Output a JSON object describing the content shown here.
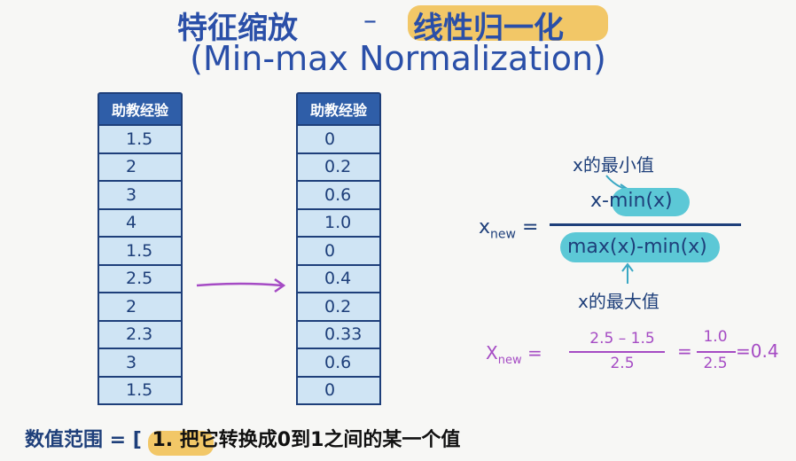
{
  "title": {
    "part1": "特征缩放",
    "separator": "–",
    "part2": "线性归一化",
    "subtitle": "(Min-max Normalization)"
  },
  "table_left": {
    "header": "助教经验",
    "values": [
      "1.5",
      "2",
      "3",
      "4",
      "1.5",
      "2.5",
      "2",
      "2.3",
      "3",
      "1.5"
    ]
  },
  "table_right": {
    "header": "助教经验",
    "values": [
      "0",
      "0.2",
      "0.6",
      "1.0",
      "0",
      "0.4",
      "0.2",
      "0.33",
      "0.6",
      "0"
    ]
  },
  "formula": {
    "lhs": "x",
    "lhs_sub": "new",
    "equals": "=",
    "min_label": "x的最小值",
    "numerator_x": "x-",
    "numerator_min": "min(x)",
    "denominator_max": "max(x)",
    "denominator_dash": "-",
    "denominator_min": "min(x)",
    "max_label": "x的最大值"
  },
  "example": {
    "lhs": "X",
    "lhs_sub": "new",
    "eq1": "=",
    "num1": "2.5 – 1.5",
    "den1": "2.5",
    "eq2": "=",
    "num2": "1.0",
    "den2": "2.5",
    "result": "=0.4"
  },
  "bottom": {
    "prefix": "数值范围 = [",
    "caption": "1. 把它转换成0到1之间的某一个值"
  },
  "colors": {
    "title_blue": "#2a4fa8",
    "highlight_yellow": "#f2c767",
    "table_header": "#2f5ea8",
    "table_cell": "#cfe4f4",
    "formula_pill": "#5cc8d6",
    "arrow_purple": "#a54bc4"
  }
}
